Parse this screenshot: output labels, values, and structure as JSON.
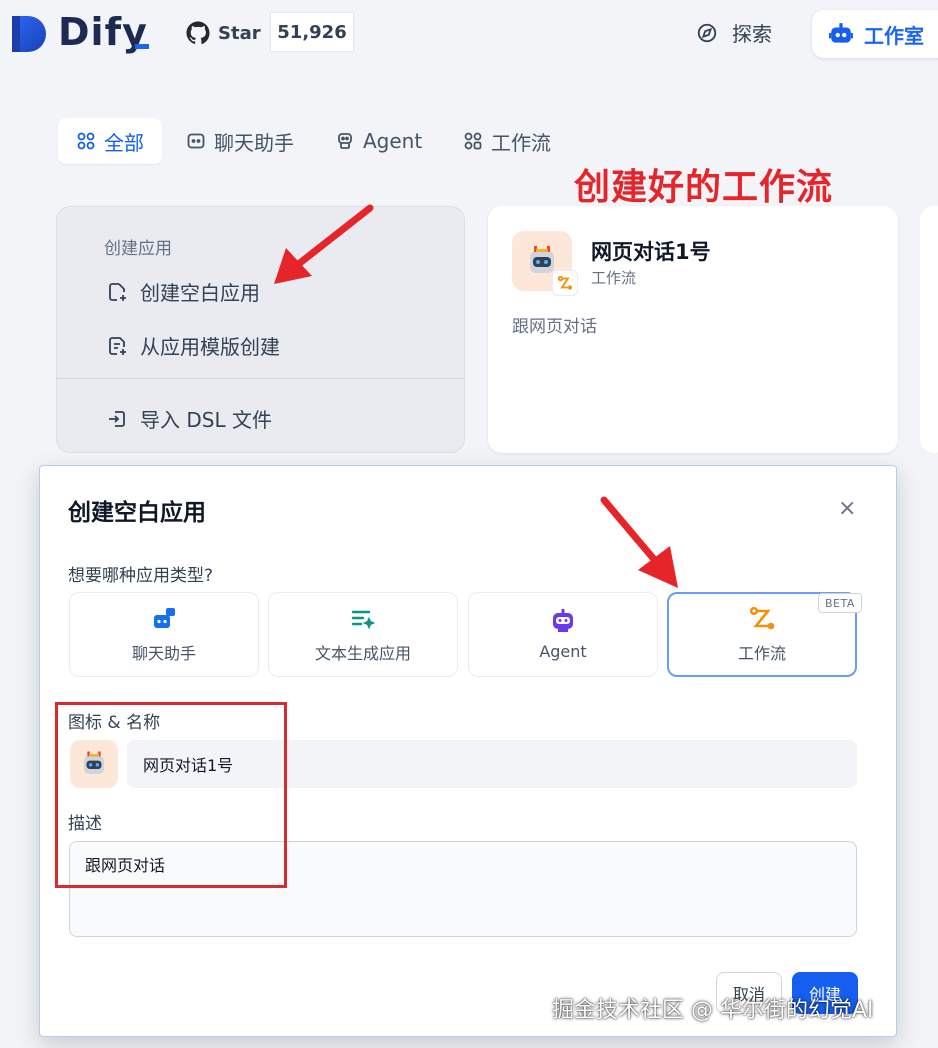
{
  "header": {
    "logo_text": "Dify",
    "github_label": "Star",
    "github_count": "51,926",
    "nav_explore": "探索",
    "nav_studio": "工作室"
  },
  "tabs": [
    {
      "label": "全部",
      "icon": "grid-icon",
      "active": true
    },
    {
      "label": "聊天助手",
      "icon": "chat-icon",
      "active": false
    },
    {
      "label": "Agent",
      "icon": "robot-icon",
      "active": false
    },
    {
      "label": "工作流",
      "icon": "workflow-icon",
      "active": false
    }
  ],
  "annotation_title": "创建好的工作流",
  "create_card": {
    "heading": "创建应用",
    "items": [
      {
        "label": "创建空白应用",
        "icon": "file-plus-icon"
      },
      {
        "label": "从应用模版创建",
        "icon": "file-template-icon"
      },
      {
        "label": "导入 DSL 文件",
        "icon": "import-icon"
      }
    ]
  },
  "app_card": {
    "name": "网页对话1号",
    "type": "工作流",
    "description": "跟网页对话"
  },
  "modal": {
    "title": "创建空白应用",
    "close": "×",
    "type_question": "想要哪种应用类型?",
    "types": [
      {
        "label": "聊天助手",
        "icon": "chat-bot-icon",
        "color": "#1570ef"
      },
      {
        "label": "文本生成应用",
        "icon": "text-gen-icon",
        "color": "#0e9384"
      },
      {
        "label": "Agent",
        "icon": "agent-icon",
        "color": "#6938ef"
      },
      {
        "label": "工作流",
        "icon": "workflow-icon",
        "color": "#f79009",
        "selected": true
      }
    ],
    "beta": "BETA",
    "icon_name_label": "图标 & 名称",
    "name_value": "网页对话1号",
    "desc_label": "描述",
    "desc_value": "跟网页对话",
    "cancel": "取消",
    "create": "创建"
  },
  "watermark": "掘金技术社区 @ 华尔街的幻觉AI",
  "colors": {
    "primary": "#155eef",
    "annotation_red": "#e5252a",
    "app_icon_bg": "#fde7d8"
  }
}
